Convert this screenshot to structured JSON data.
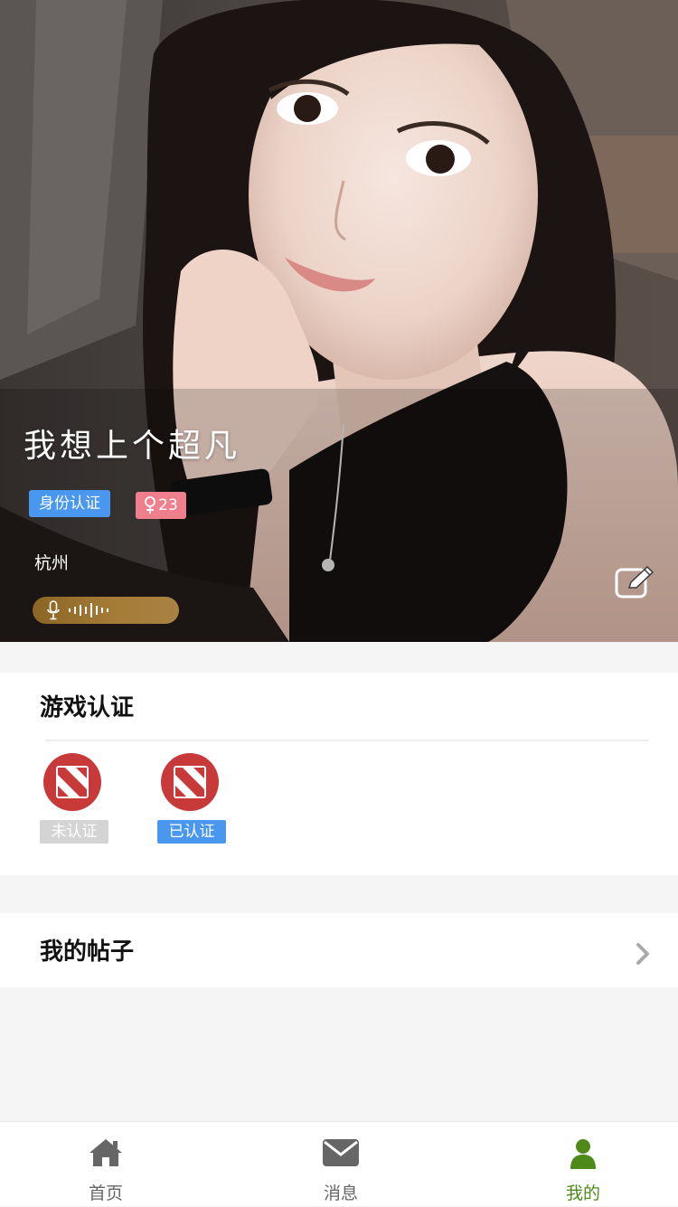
{
  "profile": {
    "username": "我想上个超凡",
    "id_badge": "身份认证",
    "age": "23",
    "city": "杭州"
  },
  "game_section": {
    "title": "游戏认证",
    "games": [
      {
        "status": "未认证",
        "status_color": "#d4d4d4"
      },
      {
        "status": "已认证",
        "status_color": "#4a97f0"
      }
    ]
  },
  "posts": {
    "title": "我的帖子"
  },
  "tabbar": {
    "items": [
      {
        "label": "首页",
        "icon": "home-icon"
      },
      {
        "label": "消息",
        "icon": "mail-icon"
      },
      {
        "label": "我的",
        "icon": "user-icon",
        "active": true
      }
    ]
  },
  "colors": {
    "accent_green": "#4e8a1a",
    "badge_blue": "#4a97f0",
    "badge_pink": "#ef7f8d",
    "game_red": "#c8393a"
  }
}
